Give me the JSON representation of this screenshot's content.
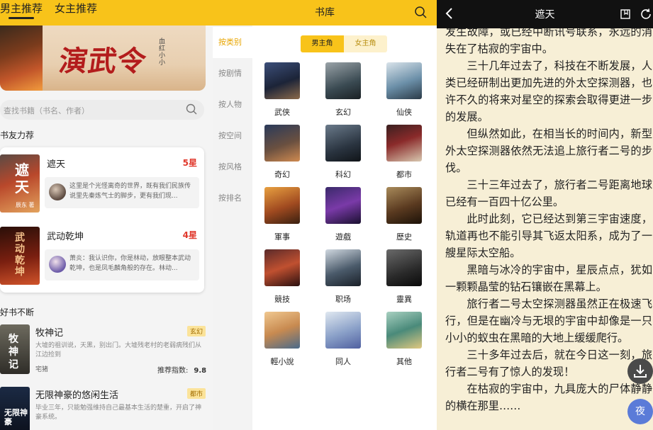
{
  "p1": {
    "tabs": [
      {
        "label": "男主推荐"
      },
      {
        "label": "女主推荐"
      }
    ],
    "banner": {
      "title": "演武令",
      "subtitle": "血红 小小"
    },
    "search": {
      "placeholder": "查找书籍（书名、作者）"
    },
    "section_recommend": "书友力荐",
    "recommend": [
      {
        "name": "遮天",
        "stars": "5星",
        "cover_text": "遮天",
        "cover_author": "辰东 著",
        "quote": "这里是个光怪离奇的世界，既有我们民族传说里先秦炼气士的脚步，更有我们现..."
      },
      {
        "name": "武动乾坤",
        "stars": "4星",
        "cover_text": "武动乾坤",
        "quote": "萧炎：我认识你，你是林动，放眼整本武动乾坤，也是凤毛麟角般的存在。林动..."
      }
    ],
    "section_list": "好书不断",
    "books": [
      {
        "name": "牧神记",
        "genre": "玄幻",
        "desc": "大墟的祖训说，天黑，别出门。大墟残老村的老弱病残们从江边捡到",
        "author": "宅猪",
        "rating_label": "推荐指数:",
        "rating": "9.8",
        "cover_text": "牧神记"
      },
      {
        "name": "无限神豪的悠闲生活",
        "genre": "都市",
        "desc": "毕业三年，只能勉强维持自己最基本生活的楚重，开启了神豪系统。",
        "cover_text": "无限神豪"
      }
    ]
  },
  "p2": {
    "title": "书库",
    "side": [
      "按类别",
      "按剧情",
      "按人物",
      "按空间",
      "按风格",
      "按排名"
    ],
    "switch": [
      "男主角",
      "女主角"
    ],
    "categories": [
      "武侠",
      "玄幻",
      "仙侠",
      "奇幻",
      "科幻",
      "都市",
      "軍事",
      "遊戲",
      "歷史",
      "競技",
      "职场",
      "靈異",
      "輕小說",
      "同人",
      "其他"
    ]
  },
  "p3": {
    "title": "遮天",
    "paragraphs": [
      {
        "t": "发生故障，或已经中断讯号联系，永远的消失在了枯寂的宇宙中。",
        "cont": true
      },
      {
        "t": "三十几年过去了，科技在不断发展，人类已经研制出更加先进的外太空探测器，也许不久的将来对星空的探索会取得更进一步的发展。"
      },
      {
        "t": "但纵然如此，在相当长的时间内，新型外太空探测器依然无法追上旅行者二号的步伐。"
      },
      {
        "t": "三十三年过去了，旅行者二号距离地球已经有一百四十亿公里。"
      },
      {
        "t": "此时此刻，它已经达到第三宇宙速度，轨道再也不能引导其飞返太阳系，成为了一艘星际太空船。"
      },
      {
        "t": "黑暗与冰冷的宇宙中，星辰点点，犹如一颗颗晶莹的钻石镶嵌在黑幕上。"
      },
      {
        "t": "旅行者二号太空探测器虽然正在极速飞行，但是在幽冷与无垠的宇宙中却像是一只小小的蚁虫在黑暗的大地上缓缓爬行。"
      },
      {
        "t": "三十多年过去后，就在今日这一刻，旅行者二号有了惊人的发现！"
      },
      {
        "t": "在枯寂的宇宙中，九具庞大的尸体静静的横在那里……"
      }
    ],
    "night_label": "夜"
  }
}
